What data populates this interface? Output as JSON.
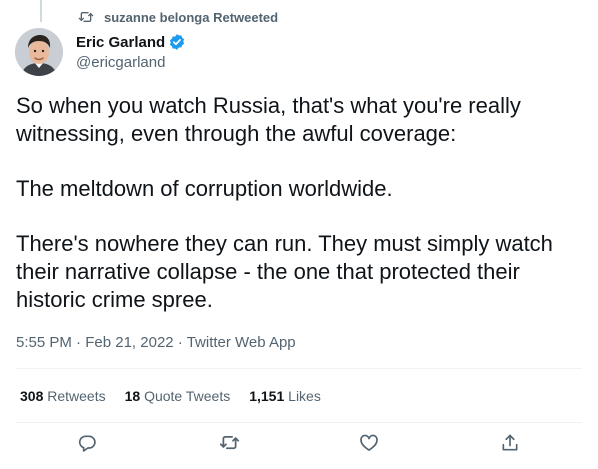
{
  "social_context": {
    "text": "suzanne belonga Retweeted",
    "icon": "retweet-icon"
  },
  "author": {
    "name": "Eric Garland",
    "handle": "@ericgarland",
    "verified": true,
    "badge_color": "#1d9bf0"
  },
  "tweet": {
    "paragraphs": [
      "So when you watch Russia, that's what you're really witnessing, even through the awful coverage:",
      "The meltdown of corruption worldwide.",
      "There's nowhere they can run. They must simply watch their narrative collapse - the one that protected their historic crime spree."
    ],
    "time": "5:55 PM",
    "date": "Feb 21, 2022",
    "source": "Twitter Web App"
  },
  "stats": {
    "retweets": {
      "count": "308",
      "label": "Retweets"
    },
    "quote_tweets": {
      "count": "18",
      "label": "Quote Tweets"
    },
    "likes": {
      "count": "1,151",
      "label": "Likes"
    }
  },
  "actions": [
    {
      "name": "reply",
      "icon": "reply-icon"
    },
    {
      "name": "retweet",
      "icon": "retweet-icon"
    },
    {
      "name": "like",
      "icon": "heart-icon"
    },
    {
      "name": "share",
      "icon": "share-icon"
    }
  ],
  "colors": {
    "text_primary": "#0f1419",
    "text_secondary": "#536471",
    "divider": "#eff3f4",
    "icon": "#536471"
  }
}
